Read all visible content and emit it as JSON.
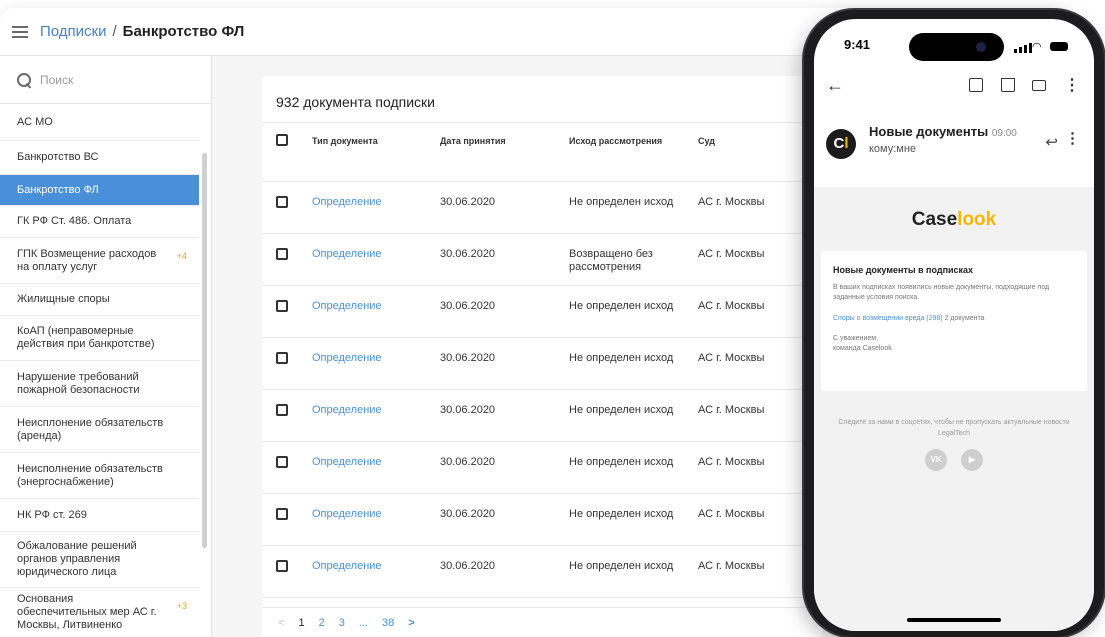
{
  "breadcrumb": {
    "parent": "Подписки",
    "separator": "/",
    "current": "Банкротство ФЛ"
  },
  "search": {
    "placeholder": "Поиск"
  },
  "sidebar": {
    "items": [
      {
        "label": "АС МО",
        "badge": ""
      },
      {
        "label": "Банкротство ВС",
        "badge": ""
      },
      {
        "label": "Банкротство ФЛ",
        "badge": "",
        "active": true
      },
      {
        "label": "ГК РФ Ст. 486. Оплата",
        "badge": ""
      },
      {
        "label": "ГПК Возмещение расходов на оплату услуг",
        "badge": "+4"
      },
      {
        "label": "Жилищные споры",
        "badge": ""
      },
      {
        "label": "КоАП (неправомерные действия при банкротстве)",
        "badge": ""
      },
      {
        "label": "Нарушение требований пожарной безопасности",
        "badge": ""
      },
      {
        "label": "Неисплонение обязательств (аренда)",
        "badge": ""
      },
      {
        "label": "Неисполнение обязательств (энергоснабжение)",
        "badge": ""
      },
      {
        "label": "НК РФ ст. 269",
        "badge": ""
      },
      {
        "label": "Обжалование решений органов управления юридического лица",
        "badge": ""
      },
      {
        "label": "Основания обеспечительных мер АС г. Москвы, Литвиненко",
        "badge": "+3"
      }
    ]
  },
  "table": {
    "title": "932 документа подписки",
    "columns": [
      "Тип документа",
      "Дата принятия",
      "Исход рассмотрения",
      "Суд"
    ],
    "rows": [
      [
        "Определение",
        "30.06.2020",
        "Не определен исход",
        "АС г. Москвы"
      ],
      [
        "Определение",
        "30.06.2020",
        "Возвращено без рассмотрения",
        "АС г. Москвы"
      ],
      [
        "Определение",
        "30.06.2020",
        "Не определен исход",
        "АС г. Москвы"
      ],
      [
        "Определение",
        "30.06.2020",
        "Не определен исход",
        "АС г. Москвы"
      ],
      [
        "Определение",
        "30.06.2020",
        "Не определен исход",
        "АС г. Москвы"
      ],
      [
        "Определение",
        "30.06.2020",
        "Не определен исход",
        "АС г. Москвы"
      ],
      [
        "Определение",
        "30.06.2020",
        "Не определен исход",
        "АС г. Москвы"
      ],
      [
        "Определение",
        "30.06.2020",
        "Не определен исход",
        "АС г. Москвы"
      ]
    ]
  },
  "pagination": {
    "prev": "<",
    "pages": [
      "1",
      "2",
      "3",
      "...",
      "38"
    ],
    "next": ">"
  },
  "phone": {
    "time": "9:41",
    "email": {
      "avatar_left": "C",
      "avatar_right": "l",
      "subject": "Новые документы",
      "received": "09:00",
      "to": "кому:мне",
      "logo_a": "Case",
      "logo_b": "look",
      "card_title": "Новые документы в подписках",
      "card_text": "В ваших подписках появились новые документы, подходящие под заданные условия поиска.",
      "link": "Споры о возмещении вреда (298)",
      "link_count": "2 документа",
      "regards_1": "С уважением,",
      "regards_2": "команда Caselook",
      "follow": "Следите за нами в соцсетях, чтобы не пропускать актуальные новости LegalTech",
      "social_vk": "VK",
      "social_yt": "▶"
    }
  },
  "colors": {
    "accent": "#4a90d9",
    "brand": "#f7b500",
    "badge": "#f0a020"
  }
}
